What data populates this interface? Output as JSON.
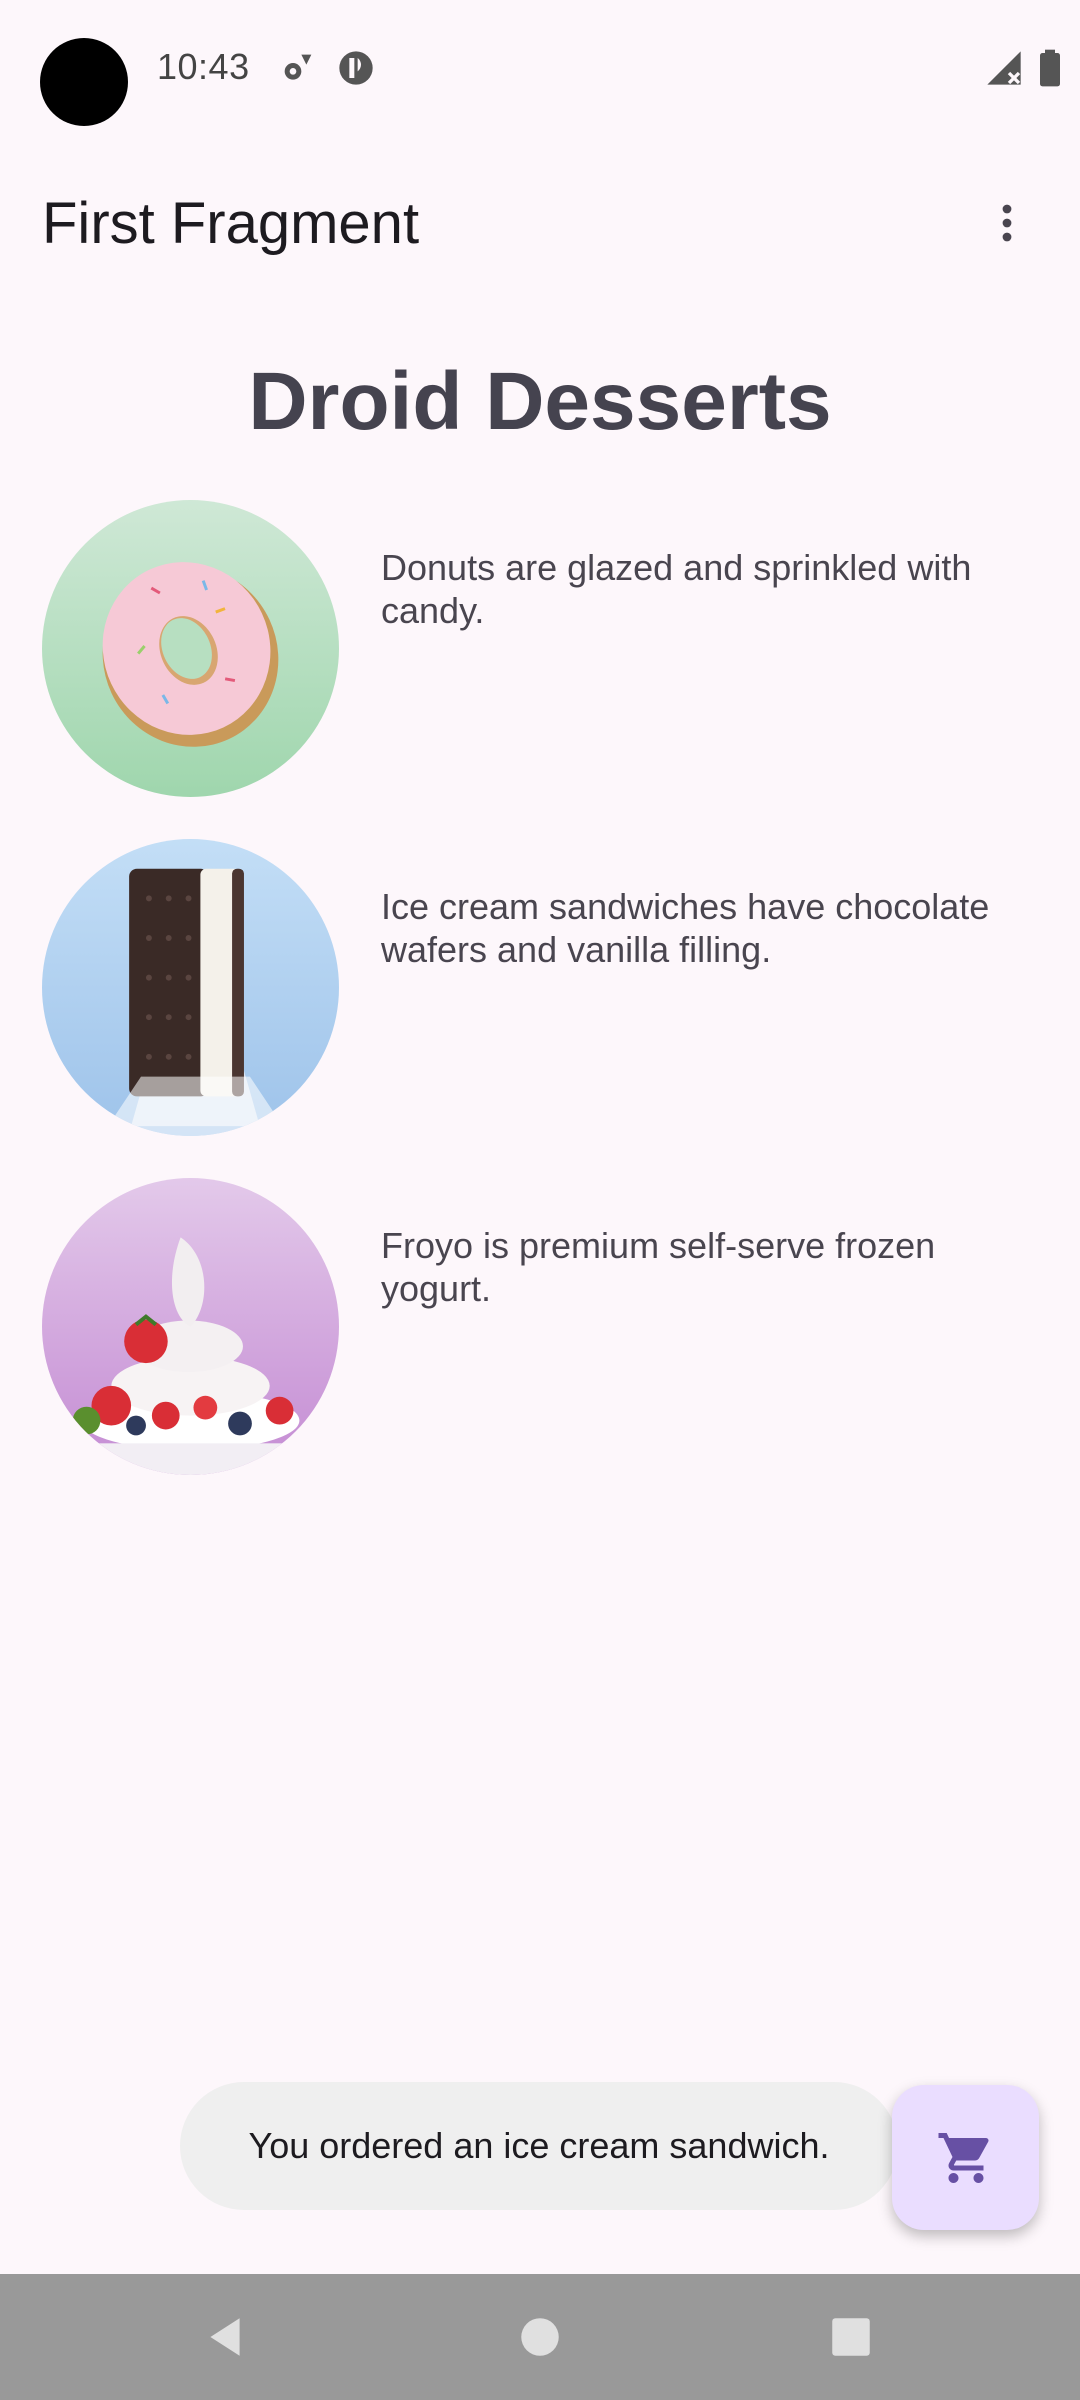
{
  "status_bar": {
    "time": "10:43",
    "icons": [
      "settings-notification-icon",
      "app-notification-icon",
      "signal-icon",
      "battery-icon"
    ]
  },
  "app_bar": {
    "title": "First Fragment",
    "overflow_icon": "more-vert-icon"
  },
  "heading": "Droid Desserts",
  "desserts": [
    {
      "image": "donut",
      "description": "Donuts are glazed and sprinkled with candy."
    },
    {
      "image": "ice-cream-sandwich",
      "description": "Ice cream sandwiches have chocolate wafers and vanilla filling."
    },
    {
      "image": "froyo",
      "description": "Froyo is premium self-serve frozen yogurt."
    }
  ],
  "snackbar": {
    "message": "You ordered an ice cream sandwich."
  },
  "fab": {
    "icon": "shopping-cart-icon"
  },
  "nav_bar": {
    "buttons": [
      "back",
      "home",
      "recents"
    ]
  },
  "colors": {
    "background": "#fdf7fb",
    "fab_background": "#eaddff",
    "fab_icon": "#6750a4",
    "snackbar_background": "#efefef",
    "nav_bar": "#999999"
  }
}
